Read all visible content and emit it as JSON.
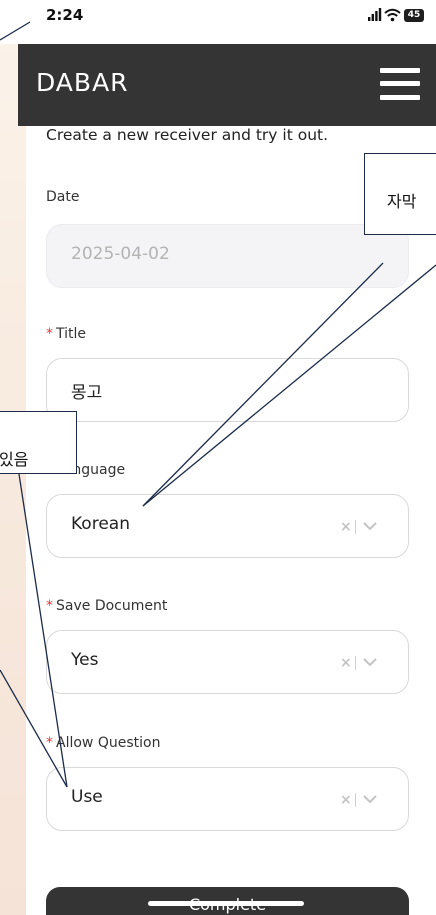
{
  "status_bar": {
    "time": "2:24",
    "battery": "45"
  },
  "header": {
    "brand": "DABAR",
    "menu_icon": "hamburger-icon"
  },
  "intro_text": "Create a new receiver and try it out.",
  "form": {
    "date": {
      "label": "Date",
      "value": "2025-04-02",
      "disabled": true
    },
    "title": {
      "label": "Title",
      "required_mark": "*",
      "value": "몽고"
    },
    "language": {
      "label": "Language",
      "required_mark": "*",
      "value": "Korean"
    },
    "save_document": {
      "label": "Save Document",
      "required_mark": "*",
      "value": "Yes"
    },
    "allow_question": {
      "label": "Allow Question",
      "required_mark": "*",
      "value": "Use"
    },
    "clear_glyph": "×",
    "submit_label": "Complete"
  },
  "annotations": {
    "left_callout": "있음",
    "right_callout": "자막"
  },
  "colors": {
    "navbar": "#343434",
    "required": "#e53935",
    "callout_border": "#1c2b4a"
  }
}
